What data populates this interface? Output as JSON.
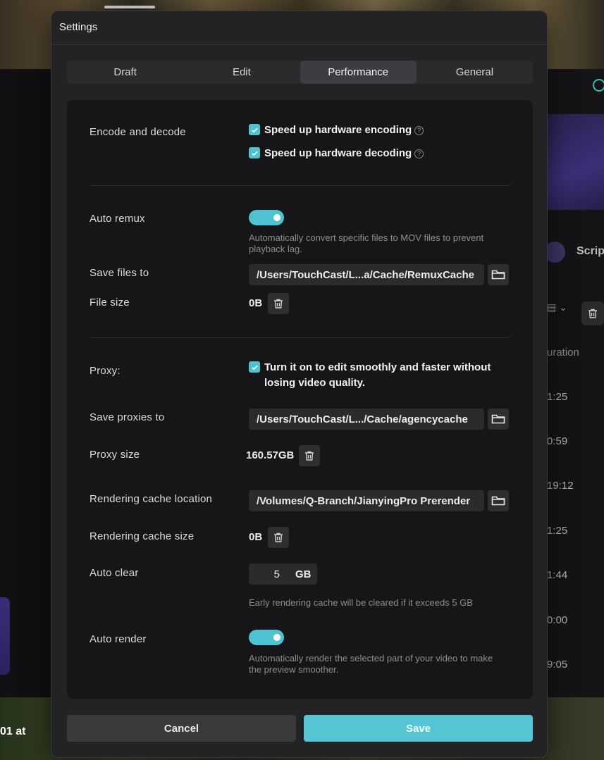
{
  "dialog": {
    "title": "Settings"
  },
  "tabs": [
    {
      "label": "Draft",
      "active": false
    },
    {
      "label": "Edit",
      "active": false
    },
    {
      "label": "Performance",
      "active": true
    },
    {
      "label": "General",
      "active": false
    }
  ],
  "encode": {
    "label": "Encode and decode",
    "hw_encoding": {
      "label": "Speed up hardware encoding",
      "checked": true
    },
    "hw_decoding": {
      "label": "Speed up hardware decoding",
      "checked": true
    }
  },
  "remux": {
    "label": "Auto remux",
    "enabled": true,
    "hint": "Automatically convert specific files to MOV files to prevent playback lag.",
    "save_label": "Save files to",
    "save_path": "/Users/TouchCast/L...a/Cache/RemuxCache",
    "size_label": "File size",
    "size_value": "0B"
  },
  "proxy": {
    "label": "Proxy:",
    "checkbox_text": "Turn it on to edit smoothly and faster without losing video quality.",
    "checked": true,
    "save_label": "Save proxies to",
    "save_path": "/Users/TouchCast/L.../Cache/agencycache",
    "size_label": "Proxy size",
    "size_value": "160.57GB"
  },
  "render_cache": {
    "location_label": "Rendering cache location",
    "location_path": "/Volumes/Q-Branch/JianyingPro Prerender",
    "size_label": "Rendering cache size",
    "size_value": "0B",
    "auto_clear_label": "Auto clear",
    "auto_clear_value": "5",
    "auto_clear_unit": "GB",
    "auto_clear_hint": "Early rendering cache will be cleared if it exceeds 5 GB"
  },
  "auto_render": {
    "label": "Auto render",
    "enabled": true,
    "hint": "Automatically render the selected part of your video to make the preview smoother."
  },
  "footer": {
    "cancel_label": "Cancel",
    "save_label": "Save"
  },
  "background": {
    "script_label": "Scrip",
    "duration_label": "uration",
    "times": [
      "1:25",
      "0:59",
      "19:12",
      "1:25",
      "1:44",
      "0:00",
      "9:05"
    ],
    "bottom_text": "01 at"
  },
  "colors": {
    "accent": "#55c4d3",
    "panel": "#161618",
    "dialog": "#232325"
  },
  "icons": {
    "check": "check-icon",
    "help": "help-icon",
    "folder": "folder-icon",
    "trash": "trash-icon"
  }
}
